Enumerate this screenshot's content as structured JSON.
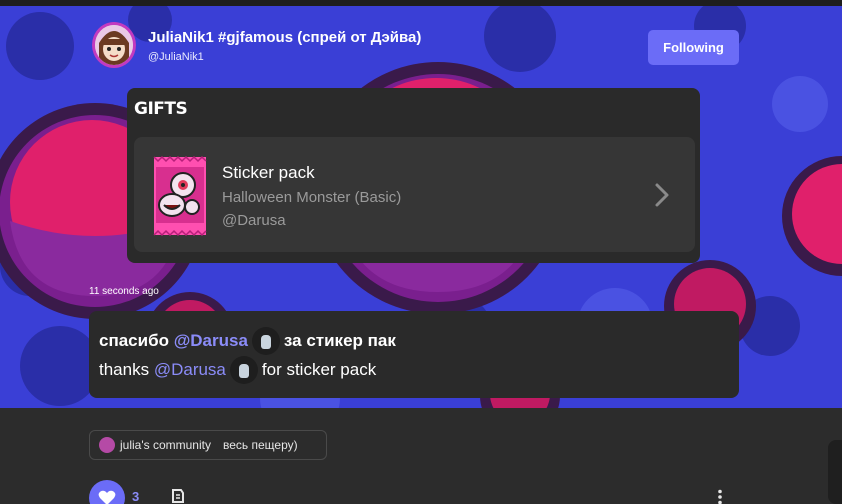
{
  "post": {
    "author_name": "JuliaNik1 #gjfamous (спрей от Дэйва)",
    "author_handle": "@JuliaNik1",
    "follow_label": "Following",
    "timestamp": "11 seconds ago"
  },
  "gifts": {
    "title": "GIFTS",
    "item": {
      "title": "Sticker pack",
      "subtitle": "Halloween Monster (Basic)",
      "sender": "@Darusa"
    }
  },
  "message": {
    "line1": {
      "before": "спасибо",
      "mention": "@Darusa",
      "after": "за стикер пак"
    },
    "line2": {
      "before": "thanks",
      "mention": "@Darusa",
      "after": "for sticker pack"
    }
  },
  "community": {
    "name": "julia's community",
    "tail": "весь пещеру)"
  },
  "actions": {
    "like_count": "3"
  },
  "colors": {
    "accent": "#6b6cf7",
    "banner_blue": "#3a3fd6",
    "banner_pink": "#e0206b"
  }
}
